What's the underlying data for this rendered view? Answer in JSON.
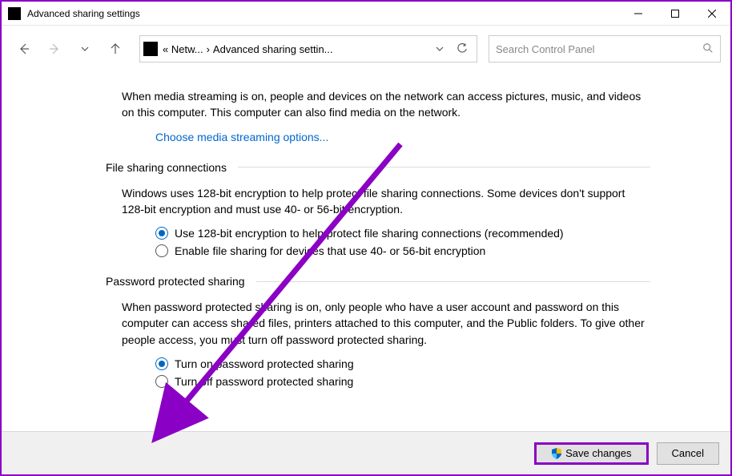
{
  "title": "Advanced sharing settings",
  "breadcrumb": {
    "seg1": "« Netw...",
    "sep": "›",
    "seg2": "Advanced sharing settin..."
  },
  "search_placeholder": "Search Control Panel",
  "media_streaming": {
    "desc": "When media streaming is on, people and devices on the network can access pictures, music, and videos on this computer. This computer can also find media on the network.",
    "link": "Choose media streaming options..."
  },
  "file_sharing": {
    "header": "File sharing connections",
    "desc": "Windows uses 128-bit encryption to help protect file sharing connections. Some devices don't support 128-bit encryption and must use 40- or 56-bit encryption.",
    "opt1": "Use 128-bit encryption to help protect file sharing connections (recommended)",
    "opt2": "Enable file sharing for devices that use 40- or 56-bit encryption"
  },
  "password": {
    "header": "Password protected sharing",
    "desc": "When password protected sharing is on, only people who have a user account and password on this computer can access shared files, printers attached to this computer, and the Public folders. To give other people access, you must turn off password protected sharing.",
    "opt1": "Turn on password protected sharing",
    "opt2": "Turn off password protected sharing"
  },
  "buttons": {
    "save": "Save changes",
    "cancel": "Cancel"
  }
}
